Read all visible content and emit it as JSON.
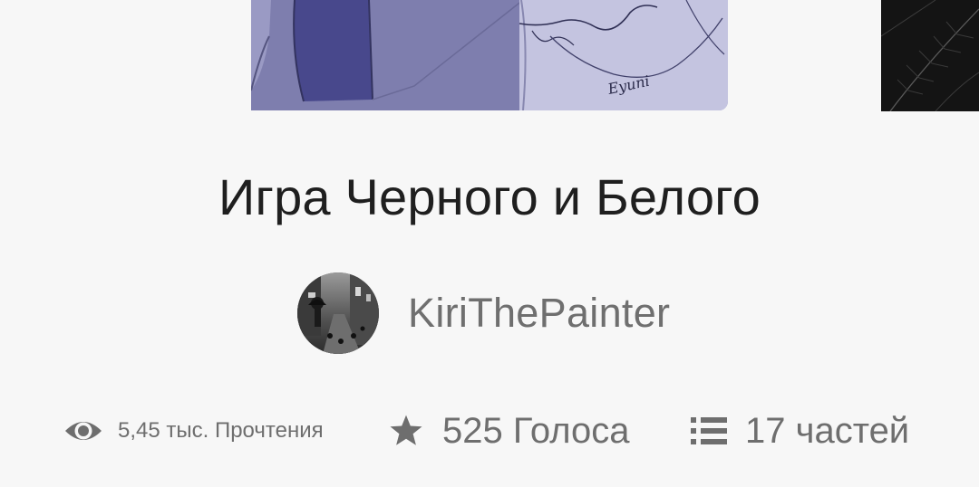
{
  "story": {
    "title": "Игра Черного и Белого",
    "cover_signature": "Eyuni"
  },
  "author": {
    "name": "KiriThePainter"
  },
  "stats": {
    "reads": "5,45 тыс. Прочтения",
    "votes": "525 Голоса",
    "parts": "17 частей"
  },
  "icons": {
    "reads": "eye-icon",
    "votes": "star-icon",
    "parts": "list-icon"
  },
  "colors": {
    "title": "#1f1f1f",
    "secondary_text": "#6e6e6e",
    "background": "#f7f7f7"
  }
}
